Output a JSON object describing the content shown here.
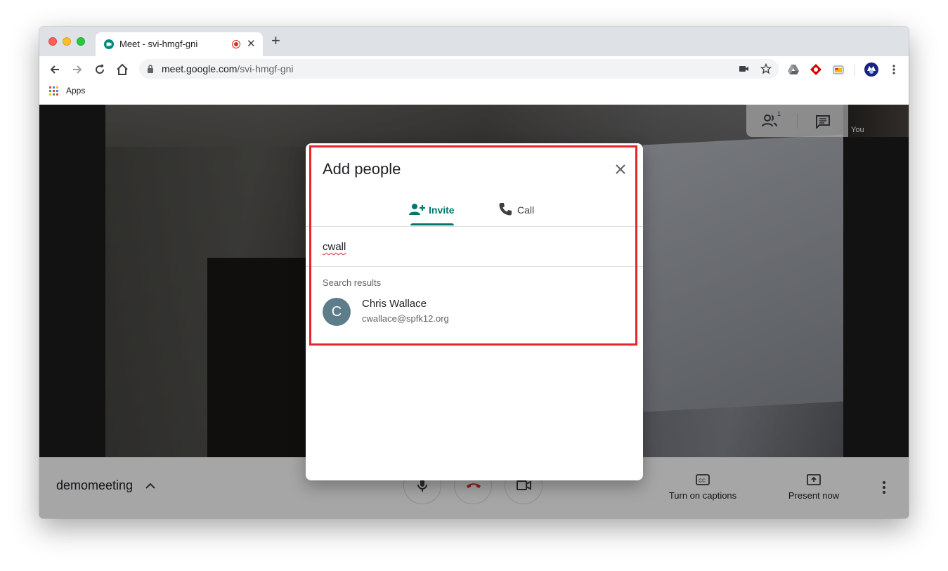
{
  "browser": {
    "tab_title": "Meet - svi-hmgf-gni",
    "new_tab_symbol": "+",
    "close_symbol": "✕",
    "url_host": "meet.google.com",
    "url_path": "/svi-hmgf-gni",
    "bookmarks": [
      {
        "label": "Apps"
      }
    ]
  },
  "meet": {
    "meeting_name": "demomeeting",
    "self_label": "You",
    "participant_count": "1",
    "actions": {
      "captions_label": "Turn on captions",
      "present_label": "Present now"
    }
  },
  "dialog": {
    "title": "Add people",
    "tabs": [
      {
        "label": "Invite",
        "active": true
      },
      {
        "label": "Call",
        "active": false
      }
    ],
    "search_value": "cwall",
    "results_label": "Search results",
    "results": [
      {
        "initial": "C",
        "name": "Chris Wallace",
        "email": "cwallace@spfk12.org"
      }
    ]
  },
  "colors": {
    "accent": "#00796b",
    "highlight_box": "#e8242e",
    "avatar_bg": "#5e7d8a",
    "hangup": "#d93025"
  }
}
